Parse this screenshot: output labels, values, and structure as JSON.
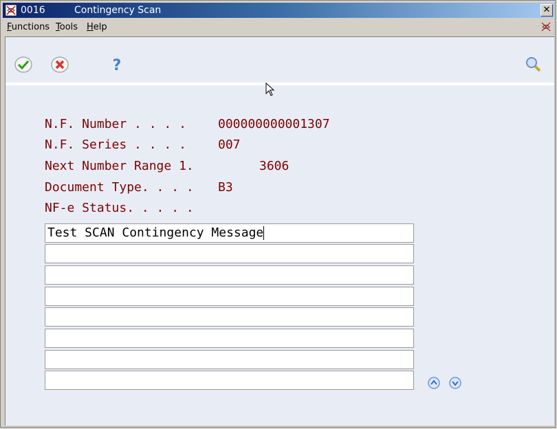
{
  "window": {
    "form_id": "0016",
    "title": "Contingency Scan",
    "close_label": "✕"
  },
  "menubar": {
    "items": [
      {
        "label": "Functions",
        "accel": "F"
      },
      {
        "label": "Tools",
        "accel": "T"
      },
      {
        "label": "Help",
        "accel": "H"
      }
    ]
  },
  "toolbar": {
    "ok_icon": "checkmark-icon",
    "cancel_icon": "x-icon",
    "help_icon": "question-icon",
    "help_label": "?",
    "find_icon": "magnifier-icon"
  },
  "fields": [
    {
      "label": "N.F. Number . . . .",
      "value": "000000000001307"
    },
    {
      "label": "N.F. Series . . . .",
      "value": "007"
    },
    {
      "label": "Next Number Range 1.",
      "value": "3606"
    },
    {
      "label": "Document Type. . . .",
      "value": "B3"
    },
    {
      "label": "NF-e Status. . . . .",
      "value": ""
    }
  ],
  "message_lines": [
    "Test SCAN Contingency Message",
    "",
    "",
    "",
    "",
    "",
    "",
    ""
  ],
  "colors": {
    "label": "#800000",
    "background": "#e8edf5",
    "title_start": "#0a246a",
    "title_end": "#a6caf0"
  }
}
